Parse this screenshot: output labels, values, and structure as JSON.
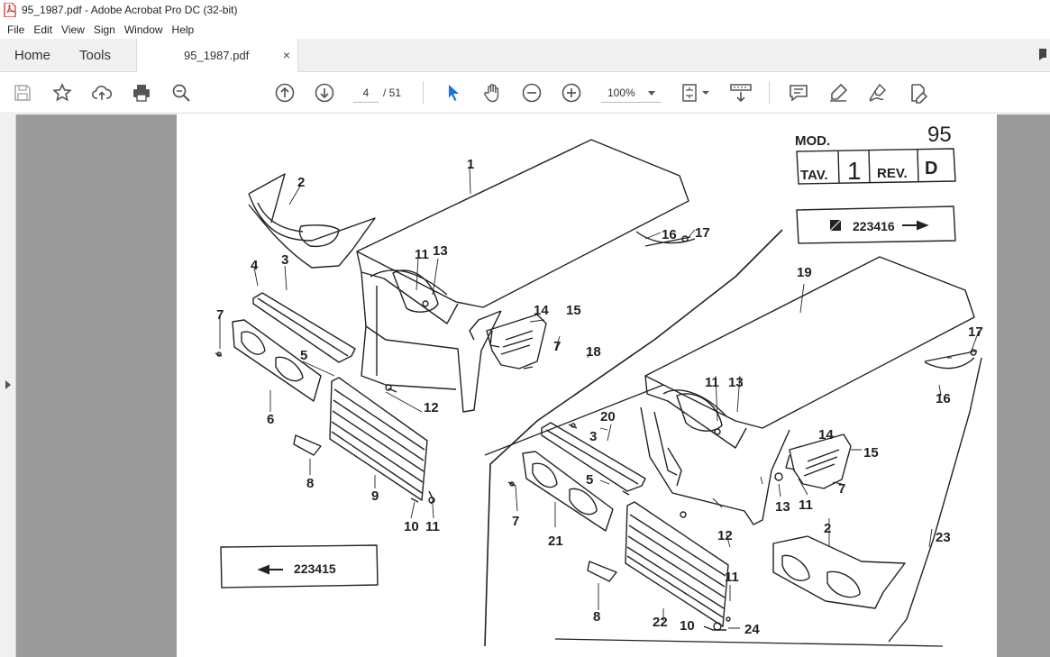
{
  "window": {
    "title": "95_1987.pdf - Adobe Acrobat Pro DC (32-bit)"
  },
  "menu": [
    "File",
    "Edit",
    "View",
    "Sign",
    "Window",
    "Help"
  ],
  "tabs": {
    "home": "Home",
    "tools": "Tools",
    "document": "95_1987.pdf",
    "close": "×"
  },
  "toolbar": {
    "current_page": "4",
    "total_pages": "/ 51",
    "zoom": "100%"
  },
  "colors": {
    "accent": "#1473e6",
    "pdf_red": "#d7261e",
    "viewer_bg": "#9a9a9a"
  },
  "doc": {
    "mod_label": "MOD.",
    "mod_value": "95",
    "tav_label": "TAV.",
    "tav_value": "1",
    "rev_label": "REV.",
    "rev_value": "D",
    "code_top": "223416",
    "code_bottom": "223415",
    "part_labels": [
      "1",
      "2",
      "3",
      "4",
      "5",
      "6",
      "7",
      "8",
      "9",
      "10",
      "11",
      "12",
      "13",
      "14",
      "15",
      "16",
      "17",
      "18",
      "19",
      "20",
      "21",
      "22",
      "23",
      "24"
    ]
  }
}
